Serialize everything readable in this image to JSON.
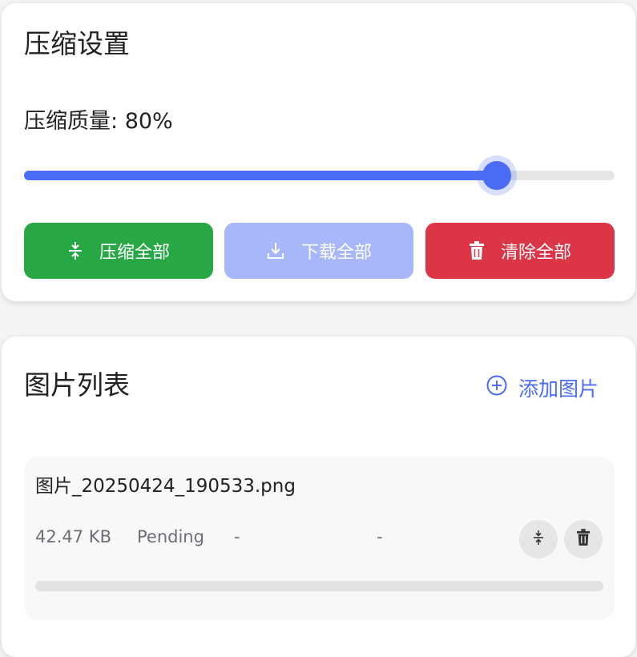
{
  "settings": {
    "title": "压缩设置",
    "quality_label": "压缩质量:",
    "quality_value": "80%",
    "quality_fraction": 0.8,
    "buttons": {
      "compress_all": "压缩全部",
      "download_all": "下载全部",
      "clear_all": "清除全部"
    }
  },
  "image_list": {
    "title": "图片列表",
    "add_label": "添加图片",
    "items": [
      {
        "name": "图片_20250424_190533.png",
        "size": "42.47 KB",
        "status": "Pending",
        "compressed_size": "-",
        "ratio": "-",
        "progress": 0
      }
    ]
  },
  "icons": {
    "compress": "compress-icon",
    "download": "download-icon",
    "trash": "trash-icon",
    "add": "plus-circle-icon"
  },
  "colors": {
    "accent": "#4a6cf7",
    "success": "#28a745",
    "danger": "#dc3545",
    "disabled_accent": "#a7b7fa"
  }
}
